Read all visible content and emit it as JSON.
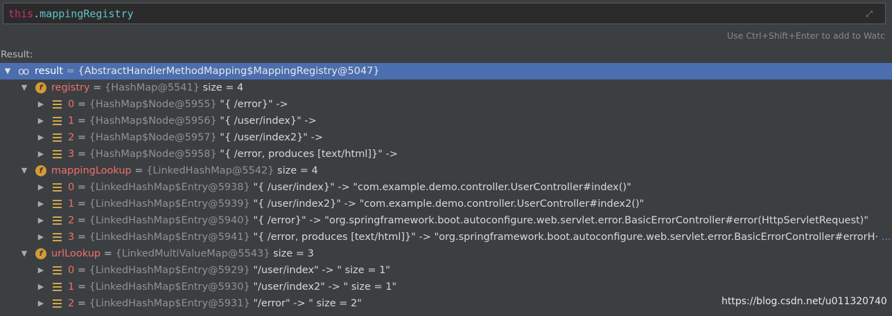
{
  "expression": {
    "this_kw": "this",
    "dot": ".",
    "field": "mappingRegistry"
  },
  "hint": "Use Ctrl+Shift+Enter to add to Watc",
  "result_label": "Result:",
  "tree": [
    {
      "level": 0,
      "toggle": "▼",
      "icon": "glasses",
      "selected": true,
      "name": "result",
      "type": "{AbstractHandlerMethodMapping$MappingRegistry@5047}",
      "value": ""
    },
    {
      "level": 1,
      "toggle": "▼",
      "icon": "field",
      "name": "registry",
      "type": "{HashMap@5541}",
      "value": " size = 4"
    },
    {
      "level": 2,
      "toggle": "▶",
      "icon": "entry",
      "name": "0",
      "type": "{HashMap$Node@5955}",
      "value": "\"{ /error}\" ->"
    },
    {
      "level": 2,
      "toggle": "▶",
      "icon": "entry",
      "name": "1",
      "type": "{HashMap$Node@5956}",
      "value": "\"{ /user/index}\" ->"
    },
    {
      "level": 2,
      "toggle": "▶",
      "icon": "entry",
      "name": "2",
      "type": "{HashMap$Node@5957}",
      "value": "\"{ /user/index2}\" ->"
    },
    {
      "level": 2,
      "toggle": "▶",
      "icon": "entry",
      "name": "3",
      "type": "{HashMap$Node@5958}",
      "value": "\"{ /error, produces [text/html]}\" ->"
    },
    {
      "level": 1,
      "toggle": "▼",
      "icon": "field",
      "name": "mappingLookup",
      "type": "{LinkedHashMap@5542}",
      "value": " size = 4"
    },
    {
      "level": 2,
      "toggle": "▶",
      "icon": "entry",
      "name": "0",
      "type": "{LinkedHashMap$Entry@5938}",
      "value": "\"{ /user/index}\" -> \"com.example.demo.controller.UserController#index()\""
    },
    {
      "level": 2,
      "toggle": "▶",
      "icon": "entry",
      "name": "1",
      "type": "{LinkedHashMap$Entry@5939}",
      "value": "\"{ /user/index2}\" -> \"com.example.demo.controller.UserController#index2()\""
    },
    {
      "level": 2,
      "toggle": "▶",
      "icon": "entry",
      "name": "2",
      "type": "{LinkedHashMap$Entry@5940}",
      "value": "\"{ /error}\" -> \"org.springframework.boot.autoconfigure.web.servlet.error.BasicErrorController#error(HttpServletRequest)\""
    },
    {
      "level": 2,
      "toggle": "▶",
      "icon": "entry",
      "name": "3",
      "type": "{LinkedHashMap$Entry@5941}",
      "value": "\"{ /error, produces [text/html]}\" -> \"org.springframework.boot.autoconfigure.web.servlet.error.BasicErrorController#errorH·",
      "link": "... Vi"
    },
    {
      "level": 1,
      "toggle": "▼",
      "icon": "field",
      "name": "urlLookup",
      "type": "{LinkedMultiValueMap@5543}",
      "value": " size = 3"
    },
    {
      "level": 2,
      "toggle": "▶",
      "icon": "entry",
      "name": "0",
      "type": "{LinkedHashMap$Entry@5929}",
      "value": "\"/user/index\" -> \" size = 1\""
    },
    {
      "level": 2,
      "toggle": "▶",
      "icon": "entry",
      "name": "1",
      "type": "{LinkedHashMap$Entry@5930}",
      "value": "\"/user/index2\" -> \" size = 1\""
    },
    {
      "level": 2,
      "toggle": "▶",
      "icon": "entry",
      "name": "2",
      "type": "{LinkedHashMap$Entry@5931}",
      "value": "\"/error\" -> \" size = 2\""
    }
  ],
  "watermark": "https://blog.csdn.net/u011320740"
}
